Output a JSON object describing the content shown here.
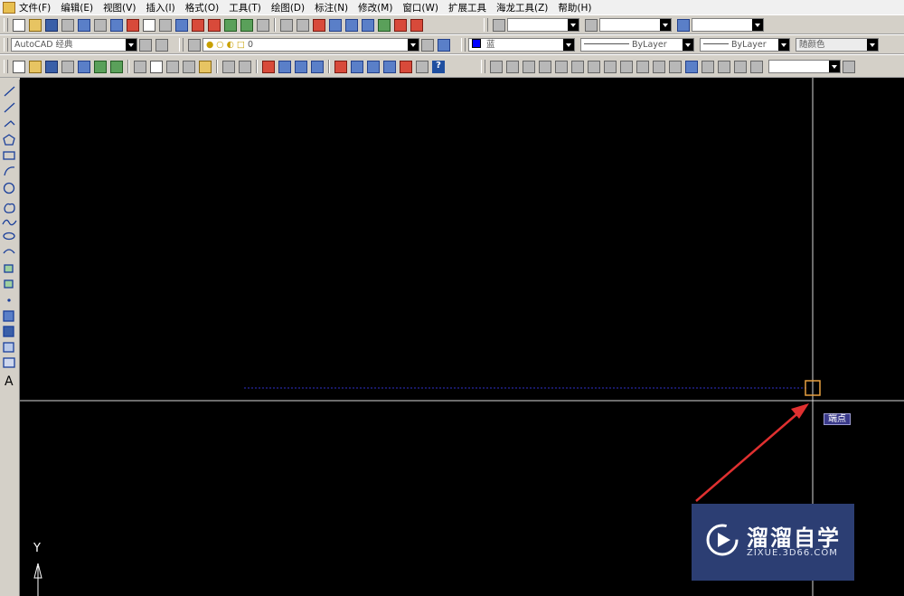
{
  "menu": [
    "文件(F)",
    "编辑(E)",
    "视图(V)",
    "插入(I)",
    "格式(O)",
    "工具(T)",
    "绘图(D)",
    "标注(N)",
    "修改(M)",
    "窗口(W)",
    "扩展工具",
    "海龙工具(Z)",
    "帮助(H)"
  ],
  "workspace": {
    "value": "AutoCAD 经典"
  },
  "layer": {
    "value": "0"
  },
  "color_combo": {
    "value": "蓝",
    "swatch": "#0000ff"
  },
  "linetype_combo": {
    "value": "ByLayer"
  },
  "lineweight_combo": {
    "value": "ByLayer"
  },
  "plotstyle_combo": {
    "value": "随颜色"
  },
  "osnap_tooltip": "端点",
  "ucs": {
    "y_label": "Y"
  },
  "watermark": {
    "title": "溜溜自学",
    "subtitle": "ZIXUE.3D66.COM"
  },
  "colors": {
    "canvas": "#000000",
    "crosshair": "#d8d8d8",
    "snap_marker": "#e8a040",
    "arrow": "#e03030",
    "dashed_line": "#3030c8"
  }
}
